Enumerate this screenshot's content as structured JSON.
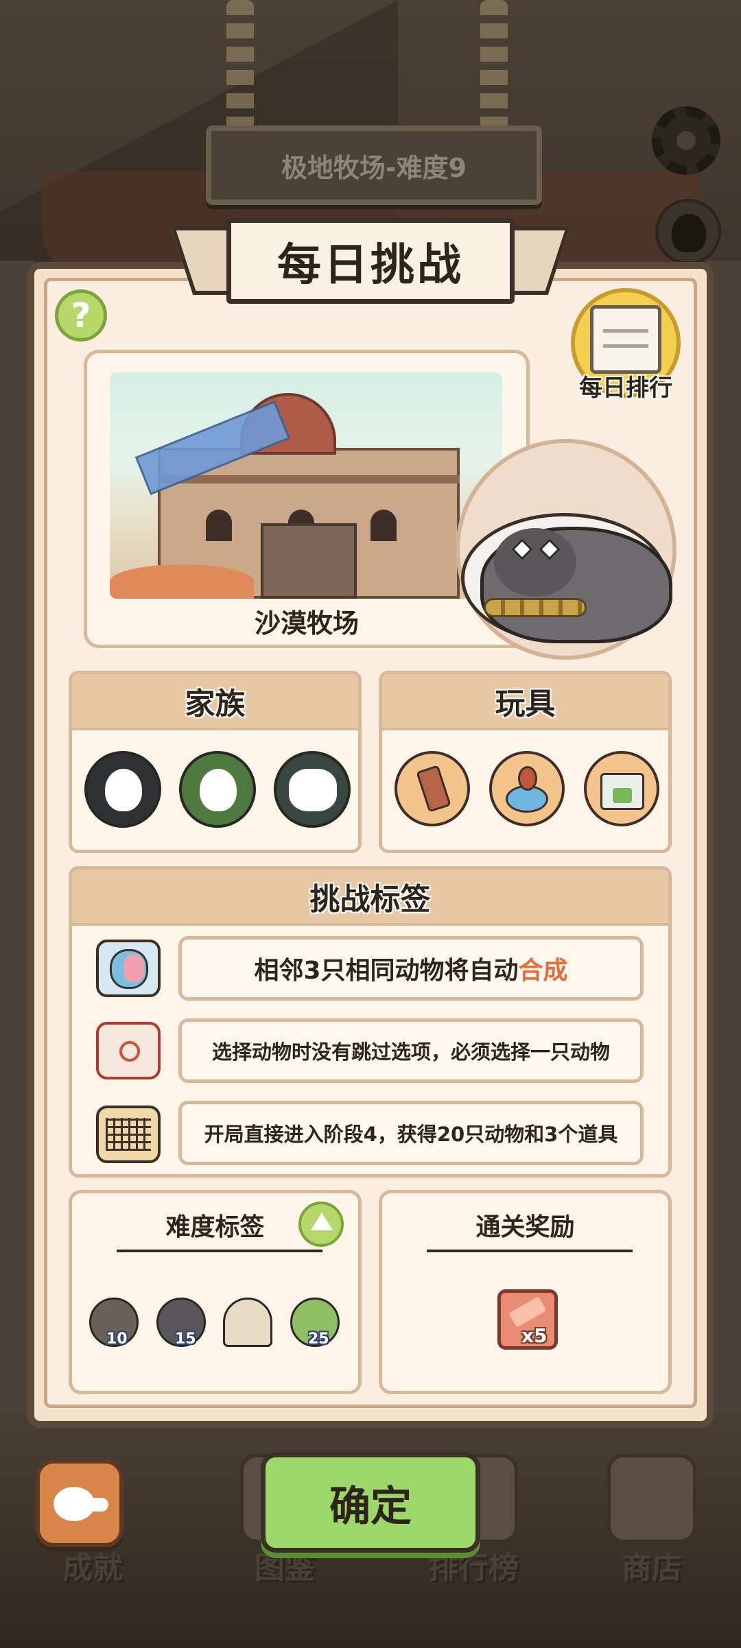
{
  "sign": {
    "level_text": "极地牧场-难度9"
  },
  "banner": {
    "title": "每日挑战"
  },
  "help": {
    "label": "?"
  },
  "ranking": {
    "label": "每日排行"
  },
  "map": {
    "name": "沙漠牧场"
  },
  "family": {
    "title": "家族",
    "icons": [
      {
        "name": "family-spiky-icon",
        "color": "#2f3133"
      },
      {
        "name": "family-round-icon",
        "color": "#4f7a3f"
      },
      {
        "name": "family-cloud-icon",
        "color": "#384742"
      }
    ]
  },
  "toys": {
    "title": "玩具",
    "icons": [
      "phone-toy-icon",
      "bell-toy-icon",
      "box-toy-icon"
    ]
  },
  "challenge_tags": {
    "title": "挑战标签",
    "items": [
      {
        "text_before": "相邻3只相同动物将自动",
        "text_accent": "合成",
        "icon": "merge-egg-icon"
      },
      {
        "text_before": "选择动物时没有跳过选项，必须选择一只动物",
        "text_accent": "",
        "icon": "no-skip-scroll-icon"
      },
      {
        "text_before": "开局直接进入阶段4，获得20只动物和3个道具",
        "text_accent": "",
        "icon": "board-grid-icon"
      }
    ],
    "accent_color": "#e96b3c"
  },
  "difficulty": {
    "title": "难度标签",
    "animals": [
      {
        "name": "raccoon-icon",
        "count": "10"
      },
      {
        "name": "gorilla-icon",
        "count": "15"
      },
      {
        "name": "hat-icon",
        "count": ""
      },
      {
        "name": "cactus-icon",
        "count": "25"
      }
    ]
  },
  "reward": {
    "title": "通关奖励",
    "count": "x5"
  },
  "confirm": {
    "label": "确定"
  },
  "nav": {
    "items": [
      {
        "label": "成就"
      },
      {
        "label": "图鉴"
      },
      {
        "label": "排行榜"
      },
      {
        "label": "商店"
      }
    ]
  }
}
